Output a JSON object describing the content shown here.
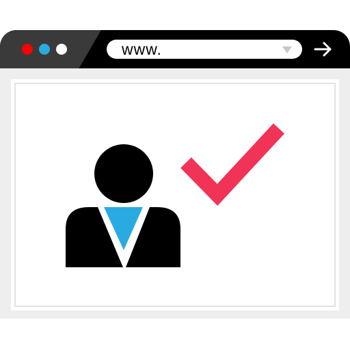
{
  "colors": {
    "titlebar": "#000000",
    "titlebar_accent": "#3a3a3a",
    "dot_close": "#ff0000",
    "dot_minimize": "#29abe2",
    "dot_zoom": "#ffffff",
    "content_frame": "#eeeeee",
    "checkmark": "#f03356",
    "tie": "#29abe2",
    "user": "#000000"
  },
  "address_bar": {
    "url": "www.",
    "dropdown_icon": "triangle-down-icon",
    "go_icon": "arrow-right-icon"
  },
  "illustration": {
    "user_icon": "user-avatar-icon",
    "check_icon": "checkmark-icon"
  }
}
